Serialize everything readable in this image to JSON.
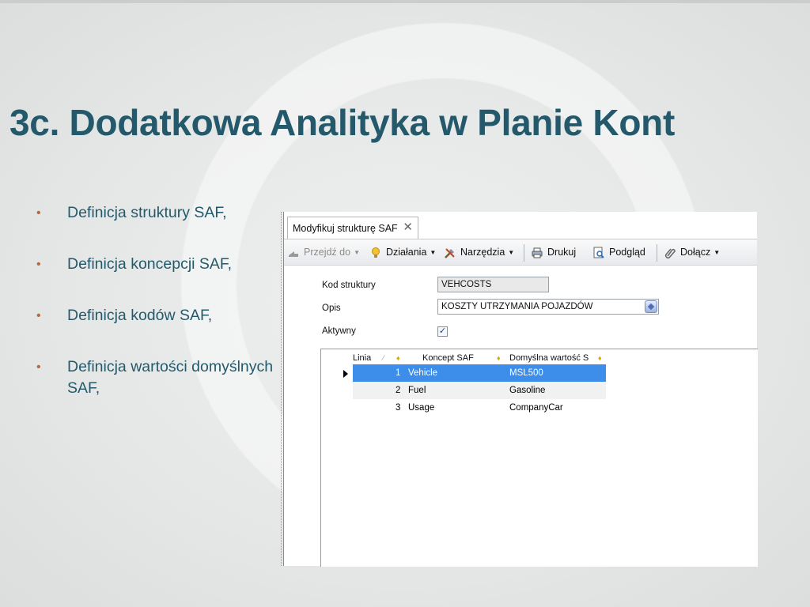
{
  "slide": {
    "title": "3c. Dodatkowa Analityka w Planie Kont",
    "bullets": [
      "Definicja struktury SAF,",
      "Definicja koncepcji SAF,",
      "Definicja kodów SAF,",
      "Definicja wartości domyślnych SAF,"
    ]
  },
  "window": {
    "tab_title": "Modyfikuj strukturę SAF",
    "tab_close": "✕",
    "toolbar": {
      "goto": "Przejdź do",
      "actions": "Działania",
      "tools": "Narzędzia",
      "print": "Drukuj",
      "preview": "Podgląd",
      "attach": "Dołącz"
    },
    "form": {
      "code_label": "Kod struktury",
      "code_value": "VEHCOSTS",
      "desc_label": "Opis",
      "desc_value": "KOSZTY UTRZYMANIA POJAZDÓW",
      "active_label": "Aktywny",
      "active_checked": true,
      "active_mark": "✓"
    },
    "grid": {
      "columns": [
        "Linia",
        "Koncept SAF",
        "Domyślna wartość S"
      ],
      "rows": [
        {
          "line": "1",
          "concept": "Vehicle",
          "default": "MSL500",
          "selected": true
        },
        {
          "line": "2",
          "concept": "Fuel",
          "default": "Gasoline",
          "selected": false
        },
        {
          "line": "3",
          "concept": "Usage",
          "default": "CompanyCar",
          "selected": false
        }
      ]
    }
  },
  "colors": {
    "title": "#23596b",
    "bullet_text": "#24596b",
    "bullet_dot": "#b46a3c",
    "selection": "#3c8eea"
  }
}
